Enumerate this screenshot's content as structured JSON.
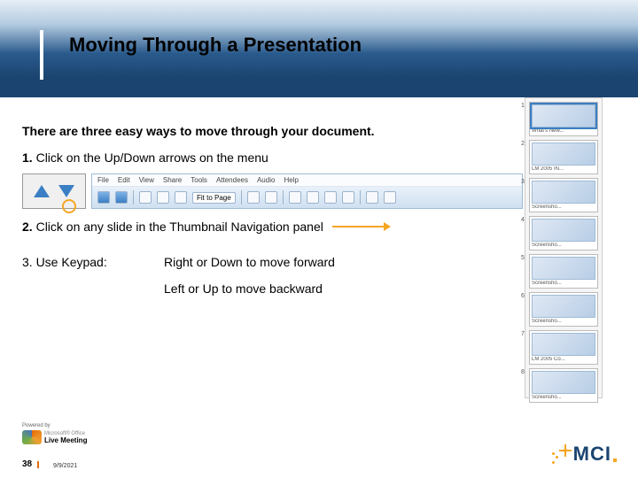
{
  "title": "Moving Through a Presentation",
  "intro": "There are three easy ways to move through your document.",
  "item1_num": "1.",
  "item1_text": " Click on the Up/Down arrows on the menu",
  "menubar_items": [
    "File",
    "Edit",
    "View",
    "Share",
    "Tools",
    "Attendees",
    "Audio",
    "Help"
  ],
  "fit_label": "Fit to Page",
  "item2_num": "2.",
  "item2_text": " Click on any slide in the Thumbnail Navigation panel",
  "item3_label": "3. Use Keypad:",
  "item3_line1": "Right or Down to move forward",
  "item3_line2": "Left or Up to move backward",
  "thumbnails": [
    {
      "n": "1",
      "cap": "What's New..."
    },
    {
      "n": "2",
      "cap": "LM 2005 IN..."
    },
    {
      "n": "3",
      "cap": "Screensho..."
    },
    {
      "n": "4",
      "cap": "Screensho..."
    },
    {
      "n": "5",
      "cap": "Screensho..."
    },
    {
      "n": "6",
      "cap": "Screensho..."
    },
    {
      "n": "7",
      "cap": "LM 2005 Co..."
    },
    {
      "n": "8",
      "cap": "Screensho..."
    }
  ],
  "powered_by": "Powered by",
  "logo_ms": "Microsoft® Office",
  "logo_lm": "Live Meeting",
  "slide_number": "38",
  "date": "9/9/2021",
  "brand": "MCI"
}
